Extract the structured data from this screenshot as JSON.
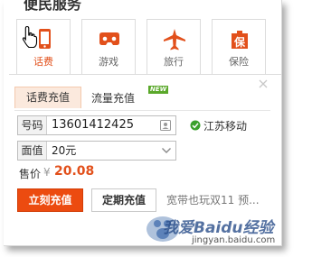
{
  "section": {
    "title": "便民服务"
  },
  "tiles": [
    {
      "label": "话费",
      "icon": "phone-icon"
    },
    {
      "label": "游戏",
      "icon": "gamepad-icon"
    },
    {
      "label": "旅行",
      "icon": "airplane-icon"
    },
    {
      "label": "保险",
      "icon": "insurance-icon"
    }
  ],
  "subtabs": {
    "active": "话费充值",
    "other": "流量充值",
    "badge": "NEW"
  },
  "form": {
    "phone_label": "号码",
    "phone_value": "13601412425",
    "carrier": "江苏移动",
    "amount_label": "面值",
    "amount_value": "20元"
  },
  "price": {
    "label": "售价",
    "currency": "¥",
    "value": "20.08"
  },
  "buttons": {
    "primary": "立刻充值",
    "secondary": "定期充值"
  },
  "promo": "宽带也玩双11 预...",
  "watermark": {
    "text": "我爱Baidu经验",
    "url": "jingyan.baidu.com"
  },
  "colors": {
    "accent": "#e2501b",
    "button": "#ec4b10",
    "success": "#3aa02b"
  }
}
